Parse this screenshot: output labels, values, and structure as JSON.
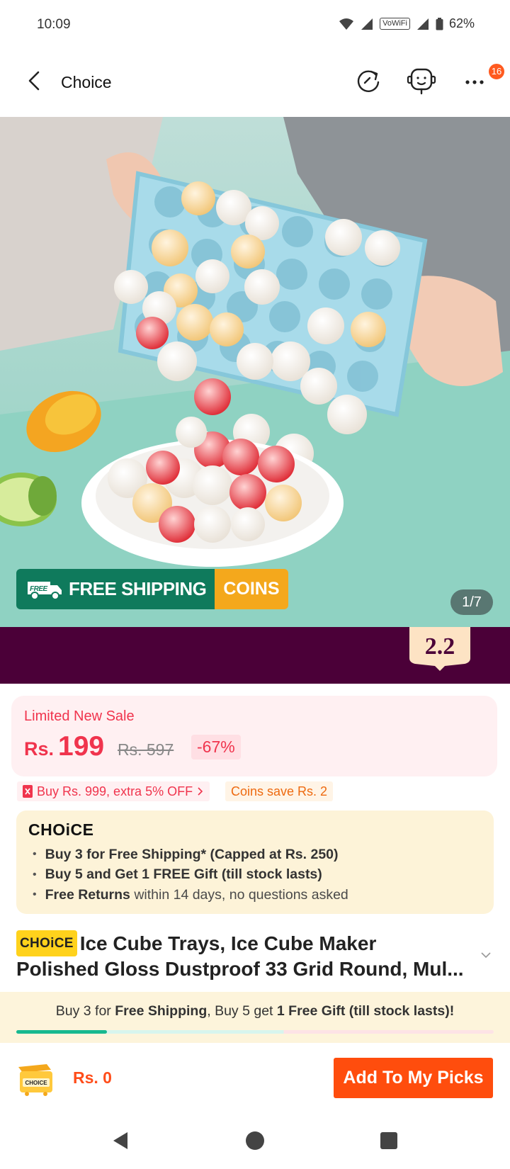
{
  "status_bar": {
    "time": "10:09",
    "network_label": "VoWiFi",
    "battery": "62%"
  },
  "header": {
    "title": "Choice",
    "notification_count": "16",
    "icons": [
      "back-icon",
      "share-icon",
      "customer-service-icon",
      "more-icon"
    ]
  },
  "gallery": {
    "free_shipping_label": "FREE SHIPPING",
    "free_tag": "FREE",
    "coins_label": "COINS",
    "counter": "1/7"
  },
  "event_badge": "2.2",
  "price": {
    "sale_label": "Limited New Sale",
    "currency": "Rs.",
    "current": "199",
    "original": "Rs. 597",
    "discount": "-67%"
  },
  "promos": {
    "coupon": "Buy Rs. 999, extra 5% OFF",
    "coins": "Coins save Rs. 2"
  },
  "choice_benefits": {
    "logo": "CHOiCE",
    "items": [
      {
        "bold": "Buy 3 for  Free Shipping* (Capped at Rs. 250)",
        "rest": ""
      },
      {
        "bold": "Buy 5 and Get 1 FREE Gift (till stock lasts)",
        "rest": ""
      },
      {
        "bold": "Free Returns",
        "rest": " within 14 days, no questions asked"
      }
    ]
  },
  "product": {
    "tag": "CHOiCE",
    "title_line1": "Ice Cube Trays, Ice Cube Maker",
    "title_line2": "Polished Gloss Dustproof 33 Grid Round, Mul..."
  },
  "bundle_bar": {
    "part1": "Buy 3 for ",
    "bold1": "Free Shipping",
    "part2": ", Buy 5 get ",
    "bold2": "1 Free Gift (till stock lasts)!",
    "progress_fraction": 0.19
  },
  "bottom_bar": {
    "cart_label": "CHOICE",
    "cart_total": "Rs. 0",
    "add_button": "Add To My Picks"
  },
  "colors": {
    "accent": "#ff4d0d",
    "sale_red": "#f0344d",
    "shipping_green": "#0f7a5c",
    "coins_orange": "#f4a81c",
    "event_purple": "#4b0038",
    "choice_yellow": "#ffd21c"
  }
}
